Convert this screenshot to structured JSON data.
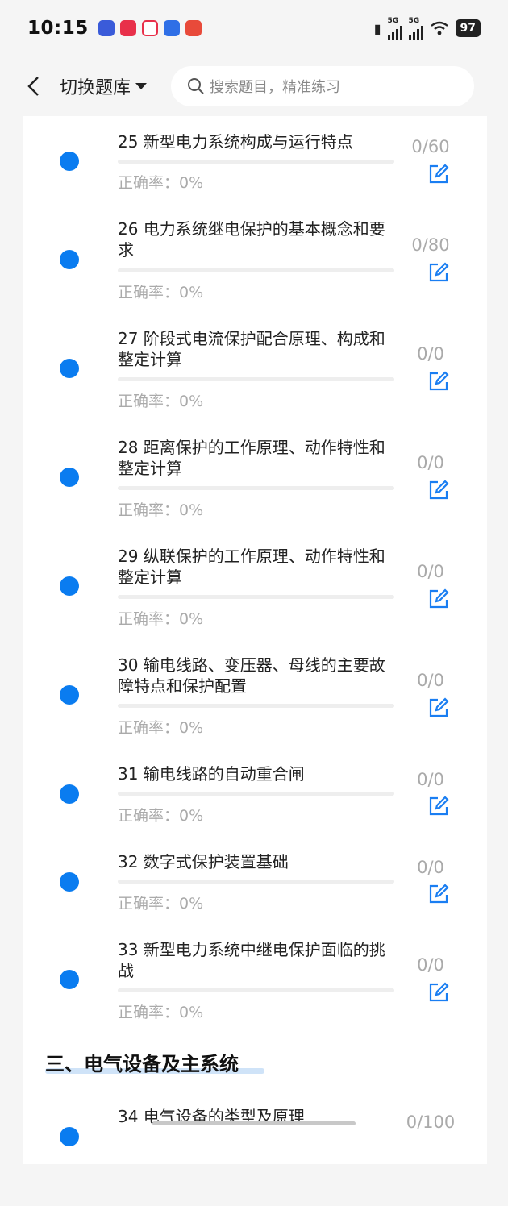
{
  "status": {
    "time": "10:15",
    "battery": "97",
    "net1": "5G",
    "net2": "5G"
  },
  "header": {
    "switch_label": "切换题库",
    "search_placeholder": "搜索题目，精准练习"
  },
  "chapters": [
    {
      "title": "25 新型电力系统构成与运行特点",
      "rate": "正确率：0%",
      "count": "0/60"
    },
    {
      "title": "26 电力系统继电保护的基本概念和要求",
      "rate": "正确率：0%",
      "count": "0/80"
    },
    {
      "title": "27 阶段式电流保护配合原理、构成和整定计算",
      "rate": "正确率：0%",
      "count": "0/0"
    },
    {
      "title": "28 距离保护的工作原理、动作特性和整定计算",
      "rate": "正确率：0%",
      "count": "0/0"
    },
    {
      "title": "29 纵联保护的工作原理、动作特性和整定计算",
      "rate": "正确率：0%",
      "count": "0/0"
    },
    {
      "title": "30 输电线路、变压器、母线的主要故障特点和保护配置",
      "rate": "正确率：0%",
      "count": "0/0"
    },
    {
      "title": "31 输电线路的自动重合闸",
      "rate": "正确率：0%",
      "count": "0/0"
    },
    {
      "title": "32 数字式保护装置基础",
      "rate": "正确率：0%",
      "count": "0/0"
    },
    {
      "title": "33 新型电力系统中继电保护面临的挑战",
      "rate": "正确率：0%",
      "count": "0/0"
    },
    {
      "title": "34 电气设备的类型及原理",
      "rate": "",
      "count": "0/100"
    }
  ],
  "section": {
    "title": "三、电气设备及主系统"
  },
  "colors": {
    "accent": "#0a7cf0",
    "muted": "#aaaaaa"
  }
}
